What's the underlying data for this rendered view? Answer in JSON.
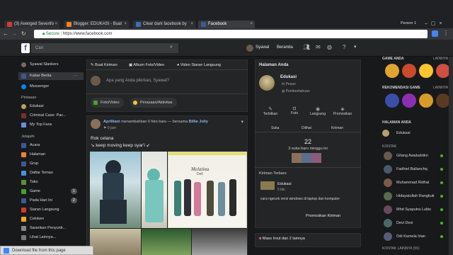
{
  "browser": {
    "tabs": [
      {
        "label": "(3) Avenged Sevenfo",
        "fav": "#d23b2d"
      },
      {
        "label": "Blogger: EDUKASI - Buat",
        "fav": "#f48120"
      },
      {
        "label": "Clear dark facebook by",
        "fav": "#3a6fb5"
      },
      {
        "label": "Facebook",
        "fav": "#3b5998"
      }
    ],
    "profile": "Person 1",
    "url": "https://www.facebook.com",
    "secure": "Secure"
  },
  "topbar": {
    "search_placeholder": "Cari",
    "user": "Syawal",
    "home": "Beranda"
  },
  "left": {
    "profile": "Syawal Slankers",
    "news": "Kabar Berita",
    "news_more": "···",
    "messenger": "Messenger",
    "shortcuts_title": "Pintasan",
    "shortcuts": [
      "Edukasi",
      "Criminal Case: Pac...",
      "My Top Fans"
    ],
    "explore_title": "Jelajahi",
    "explore": [
      "Acara",
      "Halaman",
      "Grup",
      "Daftar Teman",
      "Toko",
      "Game",
      "Pada Hari Ini",
      "Siaran Langsung",
      "Celoken",
      "Sarankan Penyunti...",
      "Lihat Lainnya..."
    ],
    "game_badge": "1",
    "today_badge": "2"
  },
  "composer": {
    "tabs": [
      "Buat Kiriman",
      "Album Foto/Video",
      "Video Siaran Langsung"
    ],
    "placeholder": "Apa yang Anda pikirkan, Syawal?",
    "photo": "Foto/Video",
    "feeling": "Perasaan/Aktivitas"
  },
  "post": {
    "author": "Aprilliani",
    "action": "menambahkan 6 foto baru — bersama",
    "with": "Billie Jolly",
    "time": "9 jam",
    "line1": "Rok celana",
    "line2": "↘ keep moving keep syar'i ↙",
    "brand": "Melatina",
    "brand2": "Dell"
  },
  "page_card": {
    "title": "Halaman Anda",
    "page": "Edukasi",
    "messages": "Pesan",
    "notifications": "Pemberitahuan",
    "actions": [
      "Terbitkan",
      "Foto",
      "Langsung",
      "Promosikan"
    ],
    "stats": [
      "Suka",
      "Dilihat",
      "Kiriman"
    ],
    "likes_count": "22",
    "likes_text": "3 suka baru minggu ini",
    "recent_title": "Kiriman Terbaru",
    "recent_page": "Edukasi",
    "recent_time": "5 bln",
    "recent_text": "cara ngecek versi windows di laptop dan komputer",
    "promote": "Promosikan Kiriman"
  },
  "event": {
    "text": "Mass Irout dan 2 lainnya"
  },
  "right": {
    "games_title": "GAME ANDA",
    "more": "LAINNYA",
    "rec_title": "REKOMENDASI GAME",
    "pages_title": "HALAMAN ANDA",
    "page": "Edukasi",
    "contacts_title": "KONTAK",
    "contacts": [
      "Gilang Awaludzikri",
      "Fadhiel Ballanchq",
      "Muhammad Ridhal",
      "Hidayatullah Rangkuti",
      "Mhd Syaputra Lubis",
      "Devi Devi",
      "Odi Kamela Irlan"
    ],
    "more_contacts": "KONTAK LAINNYA (55)"
  },
  "download_bar": "Download file from this page",
  "colors": {
    "accent": "#3b5998",
    "online": "#42b72a",
    "green": "#44a12b"
  }
}
